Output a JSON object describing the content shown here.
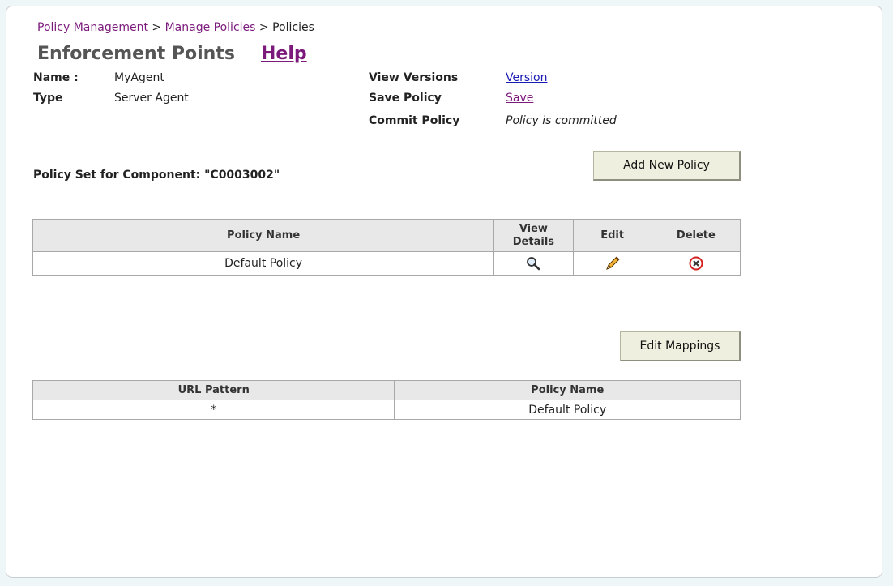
{
  "breadcrumb": {
    "items": [
      "Policy Management",
      "Manage Policies"
    ],
    "separator": ">",
    "current": "Policies"
  },
  "header": {
    "title": "Enforcement Points",
    "help": "Help"
  },
  "details": {
    "name_label": "Name :",
    "name_value": "MyAgent",
    "type_label": "Type",
    "type_value": "Server Agent",
    "view_versions_label": "View Versions",
    "view_versions_link": "Version",
    "save_policy_label": "Save Policy",
    "save_policy_link": "Save",
    "commit_policy_label": "Commit Policy",
    "commit_policy_value": "Policy is committed"
  },
  "policy_set": {
    "label": "Policy Set for Component: \"C0003002\"",
    "add_button": "Add New Policy"
  },
  "policies_table": {
    "headers": [
      "Policy Name",
      "View\nDetails",
      "Edit",
      "Delete"
    ],
    "rows": [
      {
        "name": "Default Policy",
        "view_icon": "magnifier-icon",
        "edit_icon": "pencil-icon",
        "delete_icon": "delete-icon"
      }
    ]
  },
  "mappings": {
    "edit_button": "Edit Mappings",
    "headers": [
      "URL Pattern",
      "Policy Name"
    ],
    "rows": [
      {
        "pattern": "*",
        "policy": "Default Policy"
      }
    ]
  },
  "colors": {
    "link": "#7b1a7b",
    "link_blue": "#1a1ab4",
    "button_bg": "#efefdf",
    "header_bg": "#e8e8e8",
    "delete_red": "#d42020"
  }
}
